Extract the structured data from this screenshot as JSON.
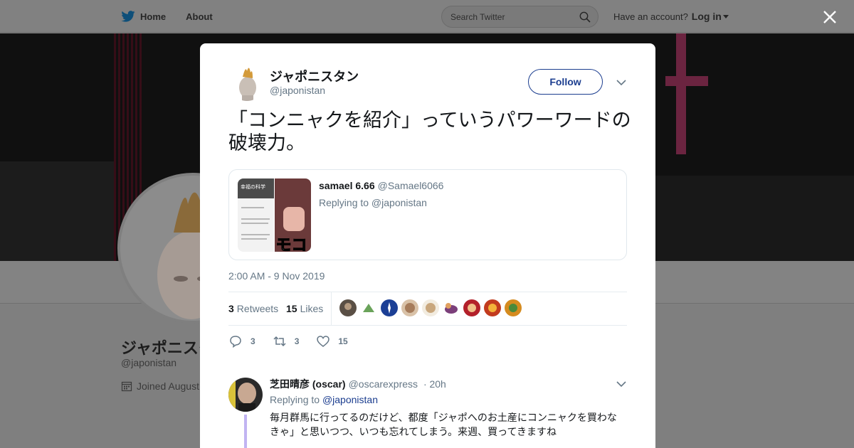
{
  "topbar": {
    "nav": [
      {
        "label": "Home",
        "icon": "twitter-bird-icon"
      },
      {
        "label": "About"
      }
    ],
    "search_placeholder": "Search Twitter",
    "account_prompt": "Have an account?",
    "login_label": "Log in"
  },
  "background_profile": {
    "name": "ジャポニスタ",
    "handle": "@japonistan",
    "joined": "Joined August"
  },
  "modal": {
    "author": {
      "name": "ジャポニスタン",
      "handle": "@japonistan"
    },
    "follow_label": "Follow",
    "tweet_text": "「コンニャクを紹介」っていうパワーワードの破壊力。",
    "quote": {
      "name": "samael 6.66",
      "handle": "@Samael6066",
      "replying_to": "Replying to @japonistan",
      "media_text_left": "幸福の科学",
      "media_text_right": "モコ"
    },
    "timestamp": "2:00 AM - 9 Nov 2019",
    "stats": {
      "retweets_count": "3",
      "retweets_label": "Retweets",
      "likes_count": "15",
      "likes_label": "Likes"
    },
    "actions": {
      "reply_count": "3",
      "retweet_count": "3",
      "like_count": "15"
    },
    "reply": {
      "name": "芝田晴彦 (oscar)",
      "handle": "@oscarexpress",
      "time": "· 20h",
      "replying_prefix": "Replying to",
      "replying_handle": "@japonistan",
      "text": "毎月群馬に行ってるのだけど、都度「ジャポへのお土産にコンニャクを買わなきゃ」と思いつつ、いつも忘れてしまう。来週、買ってきますね"
    }
  },
  "colors": {
    "accent": "#1b3d8f",
    "muted_text": "#657786",
    "thread_line": "#c1b4f2",
    "twitter_blue": "#1da1f2"
  }
}
